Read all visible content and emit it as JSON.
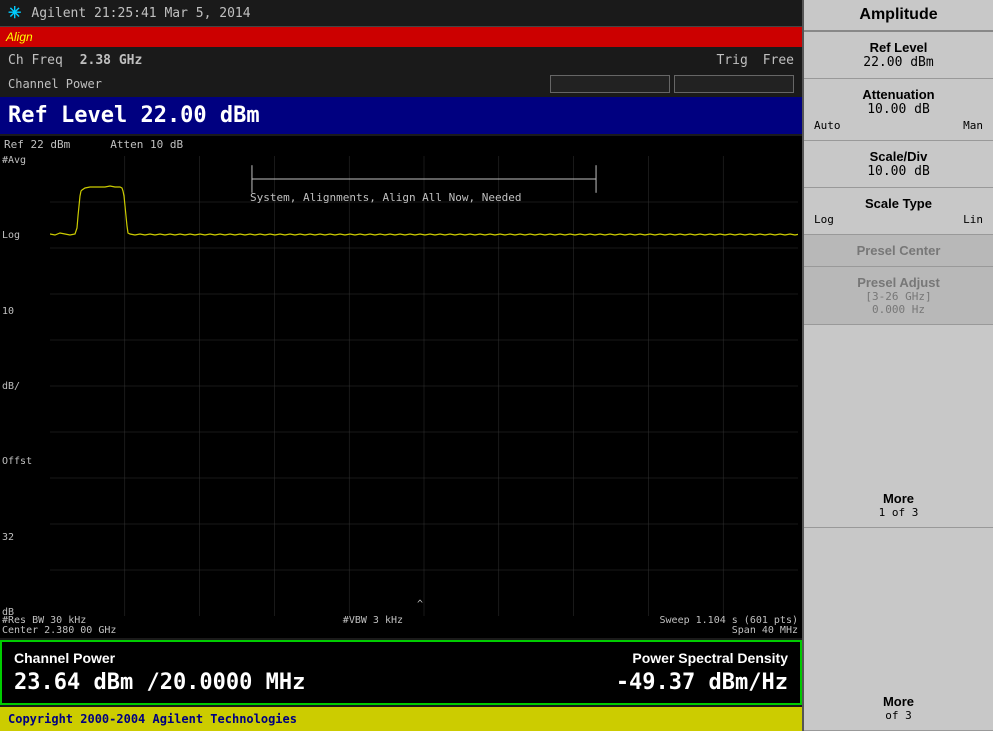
{
  "header": {
    "icon": "✳",
    "title": "Agilent  21:25:41   Mar 5, 2014"
  },
  "align": {
    "text": "Align"
  },
  "ch_freq": {
    "label": "Ch Freq",
    "value": "2.38 GHz",
    "trig_label": "Trig",
    "trig_value": "Free"
  },
  "channel_power_row": {
    "label": "Channel Power"
  },
  "ref_level_display": {
    "text": "Ref Level 22.00 dBm"
  },
  "spectrum": {
    "ref_label": "Ref 22 dBm",
    "atten_label": "Atten 10 dB",
    "avg_label": "#Avg",
    "log_label": "Log",
    "scale_label": "10",
    "db_label": "dB/",
    "offst_label": "Offst",
    "offst_value": "32",
    "db2_label": "dB",
    "center_label": "Center 2.380 00 GHz",
    "span_label": "Span 40 MHz",
    "res_bw_label": "#Res BW 30 kHz",
    "vbw_label": "#VBW 3 kHz",
    "sweep_label": "Sweep 1.104 s (601 pts)",
    "alignment_text": "System, Alignments, Align All Now, Needed"
  },
  "cp_result": {
    "channel_power_label": "Channel Power",
    "psd_label": "Power Spectral Density",
    "channel_power_value": "23.64 dBm  /20.0000 MHz",
    "psd_value": "-49.37 dBm/Hz"
  },
  "copyright": {
    "text": "Copyright 2000-2004 Agilent Technologies"
  },
  "sidebar": {
    "title": "Amplitude",
    "items": [
      {
        "label": "Ref Level",
        "value": "22.00 dBm",
        "sub": null
      },
      {
        "label": "Attenuation",
        "value": "10.00 dB",
        "sub_left": "Auto",
        "sub_right": "Man"
      },
      {
        "label": "Scale/Div",
        "value": "10.00 dB",
        "sub": null
      },
      {
        "label": "Scale Type",
        "value": null,
        "sub_left": "Log",
        "sub_right": "Lin"
      }
    ],
    "disabled_items": [
      {
        "label": "Presel Center",
        "sub": null
      },
      {
        "label": "Presel Adjust",
        "sub1": "[3-26 GHz]",
        "sub2": "0.000  Hz"
      }
    ],
    "more": {
      "label": "More",
      "value": "1 of 3"
    },
    "more2": {
      "label": "More",
      "value": "of 3"
    }
  }
}
